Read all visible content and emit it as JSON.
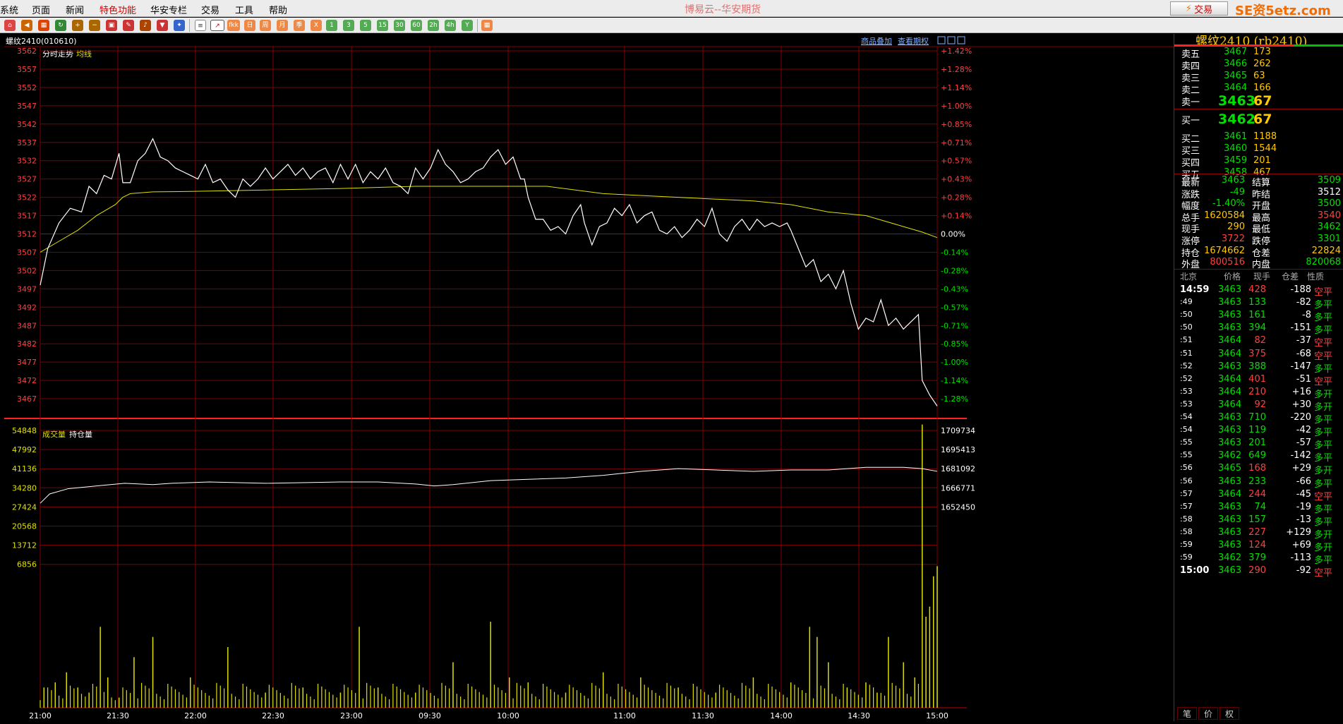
{
  "menu": [
    "系统",
    "页面",
    "新闻",
    "特色功能",
    "华安专栏",
    "交易",
    "工具",
    "帮助"
  ],
  "app_title": "博易云--华安期货",
  "trade_button": "交易",
  "brand": "SE资5etz.com",
  "toolbar_buttons": [
    "1",
    "3",
    "5",
    "15",
    "30",
    "60",
    "2h",
    "4h",
    "Y",
    "日",
    "周",
    "月",
    "季",
    "X",
    "fkk"
  ],
  "chart": {
    "instrument": "螺纹2410(010610)",
    "links": [
      "商品叠加",
      "查看期权"
    ],
    "price_label": "分时走势",
    "avg_label": "均线",
    "volume_label": "成交量",
    "oi_label": "持仓量"
  },
  "colors": {
    "price_line": "#ffffff",
    "avg_line": "#e0e000",
    "grid": "#800000",
    "volume": "#e0e000",
    "up": "#ff4040",
    "down": "#00e000"
  },
  "chart_data": {
    "type": "line",
    "price_axis": [
      "3562",
      "3557",
      "3552",
      "3547",
      "3542",
      "3537",
      "3532",
      "3527",
      "3522",
      "3517",
      "3512",
      "3507",
      "3502",
      "3497",
      "3492",
      "3487",
      "3482",
      "3477",
      "3472",
      "3467"
    ],
    "pct_axis": [
      "+1.42%",
      "+1.28%",
      "+1.14%",
      "+1.00%",
      "+0.85%",
      "+0.71%",
      "+0.57%",
      "+0.43%",
      "+0.28%",
      "+0.14%",
      "0.00%",
      "-0.14%",
      "-0.28%",
      "-0.43%",
      "-0.57%",
      "-0.71%",
      "-0.85%",
      "-1.00%",
      "-1.14%",
      "-1.28%"
    ],
    "volume_axis": [
      "54848",
      "47992",
      "41136",
      "34280",
      "27424",
      "20568",
      "13712",
      "6856"
    ],
    "oi_axis": [
      "1709734",
      "1695413",
      "1681092",
      "1666771",
      "1652450"
    ],
    "time_axis": [
      "21:00",
      "21:30",
      "22:00",
      "22:30",
      "23:00",
      "09:30",
      "10:00",
      "11:00",
      "11:30",
      "14:00",
      "14:30",
      "15:00"
    ],
    "price_ylim": [
      3465,
      3564
    ],
    "volume_ylim": [
      0,
      58000
    ],
    "oi_ylim": [
      1645000,
      1712000
    ],
    "price": [
      [
        0,
        3498
      ],
      [
        4,
        3508
      ],
      [
        10,
        3515
      ],
      [
        16,
        3519
      ],
      [
        22,
        3518
      ],
      [
        26,
        3525
      ],
      [
        30,
        3523
      ],
      [
        34,
        3528
      ],
      [
        38,
        3527
      ],
      [
        42,
        3534
      ],
      [
        44,
        3526
      ],
      [
        48,
        3526
      ],
      [
        52,
        3532
      ],
      [
        56,
        3534
      ],
      [
        60,
        3538
      ],
      [
        64,
        3533
      ],
      [
        68,
        3532
      ],
      [
        72,
        3530
      ],
      [
        76,
        3529
      ],
      [
        80,
        3528
      ],
      [
        84,
        3527
      ],
      [
        88,
        3531
      ],
      [
        92,
        3526
      ],
      [
        96,
        3527
      ],
      [
        100,
        3524
      ],
      [
        104,
        3522
      ],
      [
        108,
        3527
      ],
      [
        112,
        3525
      ],
      [
        116,
        3527
      ],
      [
        120,
        3530
      ],
      [
        124,
        3527
      ],
      [
        128,
        3529
      ],
      [
        132,
        3531
      ],
      [
        136,
        3528
      ],
      [
        140,
        3530
      ],
      [
        144,
        3527
      ],
      [
        148,
        3529
      ],
      [
        152,
        3530
      ],
      [
        156,
        3526
      ],
      [
        160,
        3531
      ],
      [
        164,
        3527
      ],
      [
        168,
        3531
      ],
      [
        172,
        3526
      ],
      [
        176,
        3529
      ],
      [
        180,
        3527
      ],
      [
        184,
        3530
      ],
      [
        188,
        3526
      ],
      [
        192,
        3525
      ],
      [
        196,
        3523
      ],
      [
        200,
        3530
      ],
      [
        204,
        3527
      ],
      [
        208,
        3530
      ],
      [
        212,
        3535
      ],
      [
        216,
        3531
      ],
      [
        220,
        3529
      ],
      [
        224,
        3526
      ],
      [
        228,
        3527
      ],
      [
        232,
        3529
      ],
      [
        236,
        3530
      ],
      [
        240,
        3533
      ],
      [
        244,
        3535
      ],
      [
        248,
        3531
      ],
      [
        252,
        3533
      ],
      [
        256,
        3527
      ],
      [
        258,
        3527
      ],
      [
        260,
        3522
      ],
      [
        264,
        3516
      ],
      [
        268,
        3516
      ],
      [
        272,
        3513
      ],
      [
        276,
        3514
      ],
      [
        280,
        3512
      ],
      [
        284,
        3517
      ],
      [
        288,
        3520
      ],
      [
        290,
        3515
      ],
      [
        294,
        3509
      ],
      [
        298,
        3514
      ],
      [
        302,
        3515
      ],
      [
        306,
        3519
      ],
      [
        310,
        3517
      ],
      [
        314,
        3520
      ],
      [
        318,
        3515
      ],
      [
        322,
        3517
      ],
      [
        326,
        3518
      ],
      [
        330,
        3513
      ],
      [
        334,
        3512
      ],
      [
        338,
        3514
      ],
      [
        342,
        3511
      ],
      [
        346,
        3513
      ],
      [
        350,
        3516
      ],
      [
        354,
        3514
      ],
      [
        358,
        3519
      ],
      [
        362,
        3512
      ],
      [
        366,
        3510
      ],
      [
        370,
        3514
      ],
      [
        374,
        3516
      ],
      [
        378,
        3513
      ],
      [
        382,
        3516
      ],
      [
        386,
        3514
      ],
      [
        390,
        3515
      ],
      [
        394,
        3514
      ],
      [
        398,
        3515
      ],
      [
        400,
        3513
      ],
      [
        404,
        3508
      ],
      [
        408,
        3503
      ],
      [
        412,
        3505
      ],
      [
        416,
        3499
      ],
      [
        420,
        3501
      ],
      [
        424,
        3497
      ],
      [
        428,
        3502
      ],
      [
        432,
        3493
      ],
      [
        436,
        3486
      ],
      [
        440,
        3489
      ],
      [
        444,
        3488
      ],
      [
        448,
        3494
      ],
      [
        452,
        3487
      ],
      [
        456,
        3489
      ],
      [
        460,
        3486
      ],
      [
        464,
        3488
      ],
      [
        468,
        3490
      ],
      [
        470,
        3472
      ],
      [
        474,
        3468
      ],
      [
        478,
        3465
      ]
    ],
    "avg": [
      [
        0,
        3507
      ],
      [
        10,
        3510
      ],
      [
        20,
        3513
      ],
      [
        30,
        3517
      ],
      [
        40,
        3520
      ],
      [
        44,
        3522
      ],
      [
        48,
        3523
      ],
      [
        60,
        3523.5
      ],
      [
        80,
        3523.6
      ],
      [
        120,
        3524
      ],
      [
        160,
        3524.4
      ],
      [
        200,
        3525
      ],
      [
        240,
        3525
      ],
      [
        270,
        3525
      ],
      [
        300,
        3523
      ],
      [
        340,
        3522
      ],
      [
        380,
        3521
      ],
      [
        400,
        3520
      ],
      [
        410,
        3519
      ],
      [
        420,
        3518
      ],
      [
        440,
        3517
      ],
      [
        460,
        3514
      ],
      [
        470,
        3512.5
      ],
      [
        478,
        3511
      ]
    ],
    "open_interest": [
      [
        0,
        1655000
      ],
      [
        5,
        1662000
      ],
      [
        15,
        1666000
      ],
      [
        30,
        1668000
      ],
      [
        45,
        1670000
      ],
      [
        60,
        1669000
      ],
      [
        70,
        1670000
      ],
      [
        90,
        1671000
      ],
      [
        120,
        1670000
      ],
      [
        160,
        1671000
      ],
      [
        180,
        1671000
      ],
      [
        200,
        1669500
      ],
      [
        210,
        1668000
      ],
      [
        220,
        1669000
      ],
      [
        240,
        1672000
      ],
      [
        260,
        1673000
      ],
      [
        280,
        1674000
      ],
      [
        300,
        1676000
      ],
      [
        320,
        1679000
      ],
      [
        340,
        1681000
      ],
      [
        360,
        1680000
      ],
      [
        380,
        1679000
      ],
      [
        400,
        1680000
      ],
      [
        420,
        1680000
      ],
      [
        440,
        1682000
      ],
      [
        460,
        1682000
      ],
      [
        470,
        1681000
      ],
      [
        478,
        1679000
      ]
    ],
    "volume": [
      [
        2,
        4000
      ],
      [
        8,
        5000
      ],
      [
        14,
        7000
      ],
      [
        20,
        4000
      ],
      [
        26,
        3000
      ],
      [
        32,
        16000
      ],
      [
        36,
        6000
      ],
      [
        42,
        2000
      ],
      [
        50,
        10000
      ],
      [
        60,
        14000
      ],
      [
        80,
        6000
      ],
      [
        100,
        12000
      ],
      [
        120,
        3000
      ],
      [
        140,
        4000
      ],
      [
        160,
        3000
      ],
      [
        170,
        16000
      ],
      [
        180,
        4000
      ],
      [
        200,
        3000
      ],
      [
        220,
        9000
      ],
      [
        240,
        17000
      ],
      [
        250,
        6000
      ],
      [
        260,
        5000
      ],
      [
        280,
        3000
      ],
      [
        300,
        7000
      ],
      [
        320,
        6000
      ],
      [
        340,
        4000
      ],
      [
        360,
        3000
      ],
      [
        380,
        6000
      ],
      [
        400,
        5000
      ],
      [
        410,
        16000
      ],
      [
        414,
        14000
      ],
      [
        420,
        9000
      ],
      [
        430,
        4000
      ],
      [
        440,
        5000
      ],
      [
        446,
        3000
      ],
      [
        452,
        14000
      ],
      [
        460,
        9000
      ],
      [
        466,
        6000
      ],
      [
        470,
        56000
      ],
      [
        472,
        18000
      ],
      [
        474,
        20000
      ],
      [
        476,
        26000
      ],
      [
        478,
        28000
      ]
    ]
  },
  "quote": {
    "title": "螺纹2410 (rb2410)",
    "sells": [
      {
        "label": "卖五",
        "price": "3467",
        "vol": "173"
      },
      {
        "label": "卖四",
        "price": "3466",
        "vol": "262"
      },
      {
        "label": "卖三",
        "price": "3465",
        "vol": "63"
      },
      {
        "label": "卖二",
        "price": "3464",
        "vol": "166"
      },
      {
        "label": "卖一",
        "price": "3463",
        "vol": "67"
      }
    ],
    "buys": [
      {
        "label": "买一",
        "price": "3462",
        "vol": "67"
      },
      {
        "label": "买二",
        "price": "3461",
        "vol": "1188"
      },
      {
        "label": "买三",
        "price": "3460",
        "vol": "1544"
      },
      {
        "label": "买四",
        "price": "3459",
        "vol": "201"
      },
      {
        "label": "买五",
        "price": "3458",
        "vol": "467"
      }
    ],
    "stats": [
      {
        "l1": "最新",
        "v1": "3463",
        "l2": "结算",
        "v2": "3509"
      },
      {
        "l1": "涨跌",
        "v1": "-49",
        "l2": "昨结",
        "v2": "3512"
      },
      {
        "l1": "幅度",
        "v1": "-1.40%",
        "l2": "开盘",
        "v2": "3500"
      },
      {
        "l1": "总手",
        "v1": "1620584",
        "l2": "最高",
        "v2": "3540"
      },
      {
        "l1": "现手",
        "v1": "290",
        "l2": "最低",
        "v2": "3462"
      },
      {
        "l1": "涨停",
        "v1": "3722",
        "l2": "跌停",
        "v2": "3301"
      },
      {
        "l1": "持仓",
        "v1": "1674662",
        "l2": "仓差",
        "v2": "22824"
      },
      {
        "l1": "外盘",
        "v1": "800516",
        "l2": "内盘",
        "v2": "820068"
      }
    ],
    "ticks_header": [
      "北京",
      "价格",
      "现手",
      "仓差",
      "性质"
    ],
    "ticks": [
      {
        "t": "14:59",
        "p": "3463",
        "v": "428",
        "d": "-188",
        "n": "空平"
      },
      {
        "t": ":49",
        "p": "3463",
        "v": "133",
        "d": "-82",
        "n": "多平"
      },
      {
        "t": ":50",
        "p": "3463",
        "v": "161",
        "d": "-8",
        "n": "多平"
      },
      {
        "t": ":50",
        "p": "3463",
        "v": "394",
        "d": "-151",
        "n": "多平"
      },
      {
        "t": ":51",
        "p": "3464",
        "v": "82",
        "d": "-37",
        "n": "空平"
      },
      {
        "t": ":51",
        "p": "3464",
        "v": "375",
        "d": "-68",
        "n": "空平"
      },
      {
        "t": ":52",
        "p": "3463",
        "v": "388",
        "d": "-147",
        "n": "多平"
      },
      {
        "t": ":52",
        "p": "3464",
        "v": "401",
        "d": "-51",
        "n": "空平"
      },
      {
        "t": ":53",
        "p": "3464",
        "v": "210",
        "d": "+16",
        "n": "多开"
      },
      {
        "t": ":53",
        "p": "3464",
        "v": "92",
        "d": "+30",
        "n": "多开"
      },
      {
        "t": ":54",
        "p": "3463",
        "v": "710",
        "d": "-220",
        "n": "多平"
      },
      {
        "t": ":54",
        "p": "3463",
        "v": "119",
        "d": "-42",
        "n": "多平"
      },
      {
        "t": ":55",
        "p": "3463",
        "v": "201",
        "d": "-57",
        "n": "多平"
      },
      {
        "t": ":55",
        "p": "3462",
        "v": "649",
        "d": "-142",
        "n": "多平"
      },
      {
        "t": ":56",
        "p": "3465",
        "v": "168",
        "d": "+29",
        "n": "多开"
      },
      {
        "t": ":56",
        "p": "3463",
        "v": "233",
        "d": "-66",
        "n": "多平"
      },
      {
        "t": ":57",
        "p": "3464",
        "v": "244",
        "d": "-45",
        "n": "空平"
      },
      {
        "t": ":57",
        "p": "3463",
        "v": "74",
        "d": "-19",
        "n": "多平"
      },
      {
        "t": ":58",
        "p": "3463",
        "v": "157",
        "d": "-13",
        "n": "多平"
      },
      {
        "t": ":58",
        "p": "3463",
        "v": "227",
        "d": "+129",
        "n": "多开"
      },
      {
        "t": ":59",
        "p": "3463",
        "v": "124",
        "d": "+69",
        "n": "多开"
      },
      {
        "t": ":59",
        "p": "3462",
        "v": "379",
        "d": "-113",
        "n": "多平"
      },
      {
        "t": "15:00",
        "p": "3463",
        "v": "290",
        "d": "-92",
        "n": "空平"
      }
    ],
    "tabs": [
      "笔",
      "价",
      "权"
    ]
  }
}
